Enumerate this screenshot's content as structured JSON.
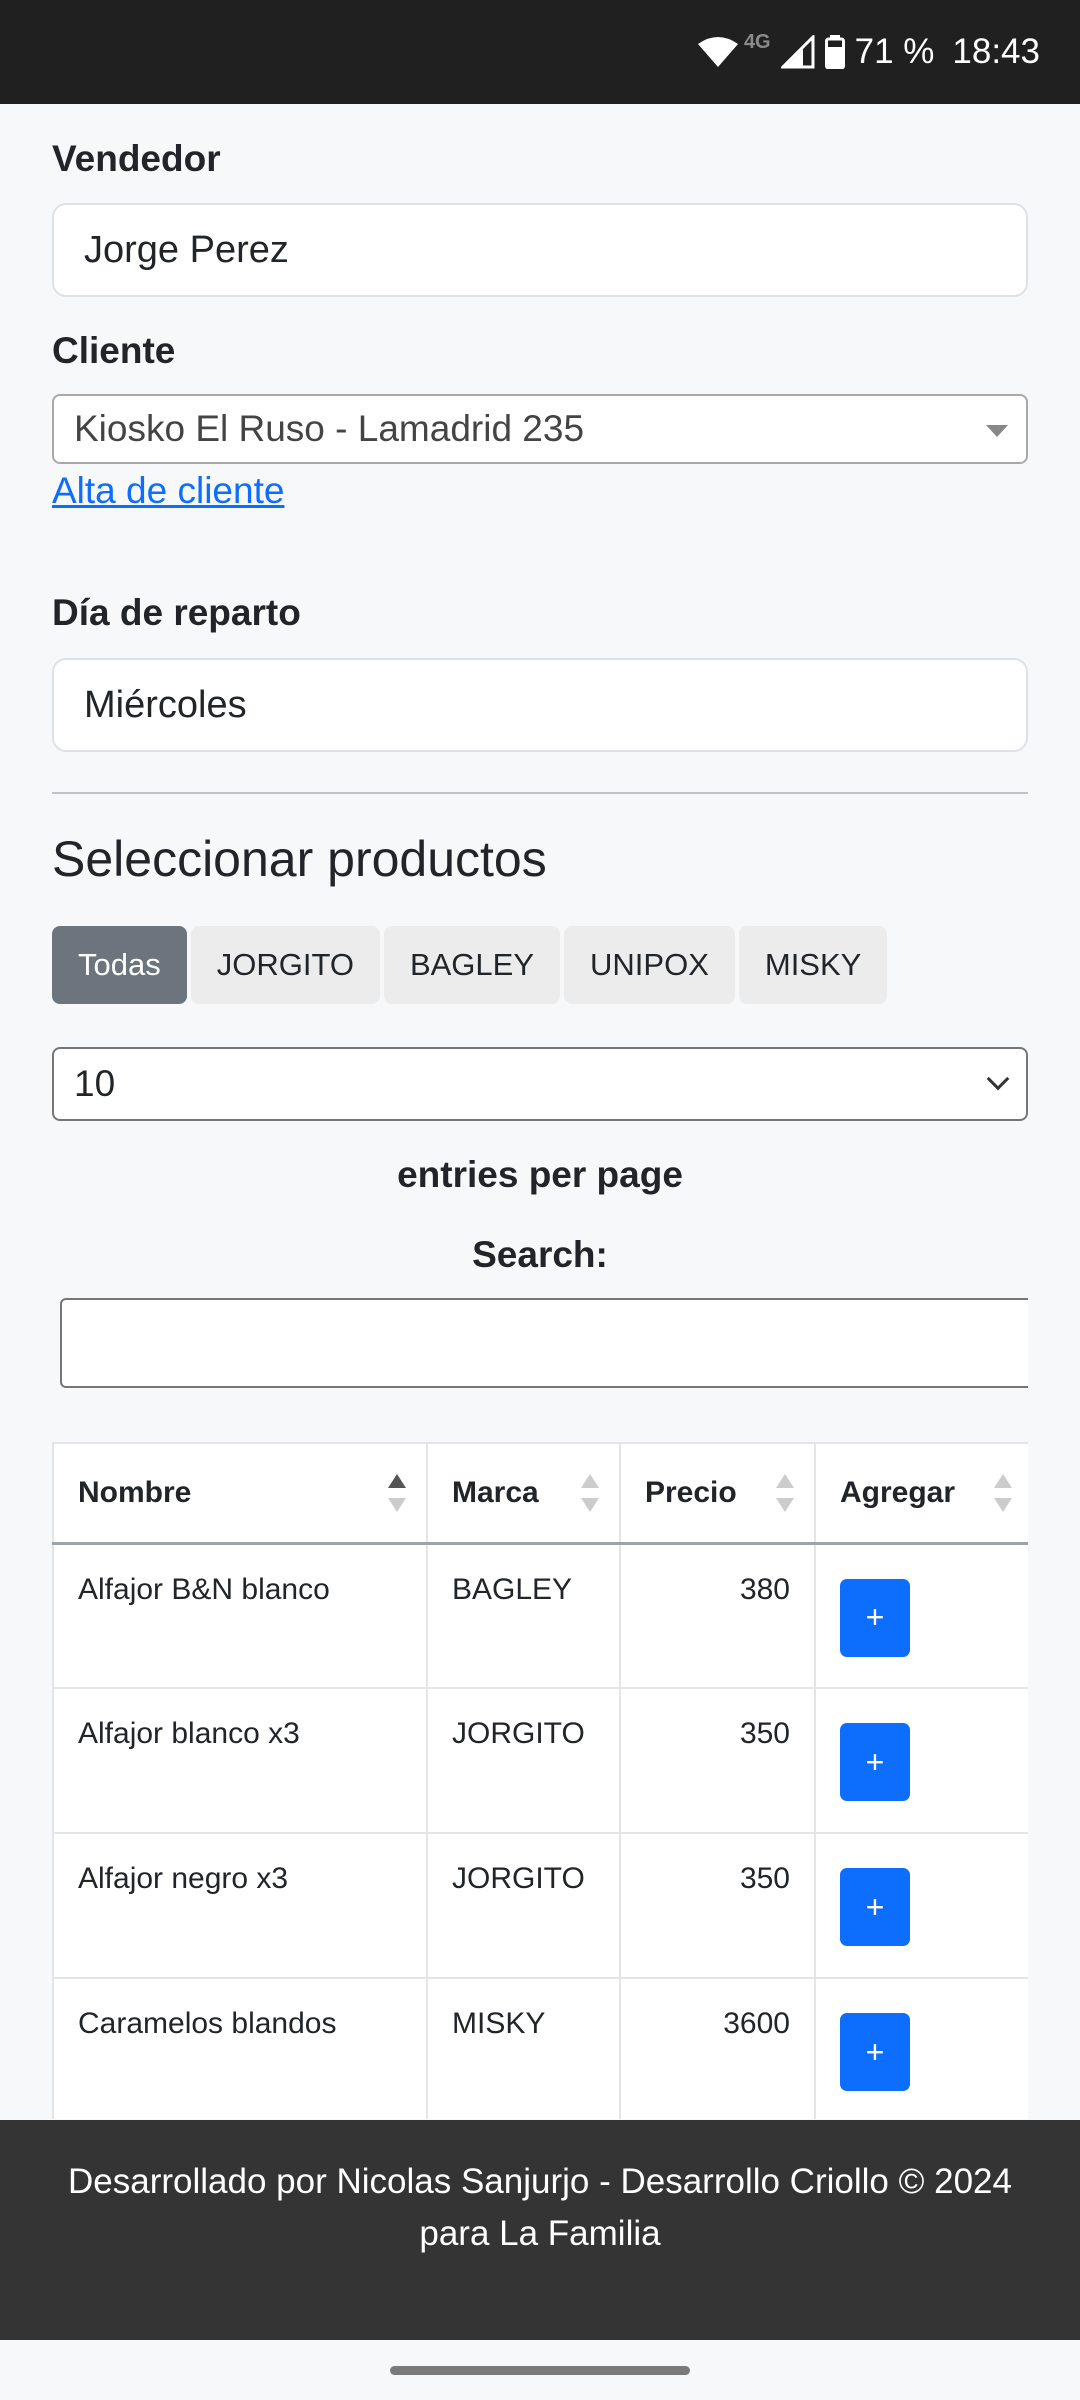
{
  "status_bar": {
    "network": "4G",
    "battery": "71 %",
    "time": "18:43"
  },
  "form": {
    "vendedor_label": "Vendedor",
    "vendedor_value": "Jorge Perez",
    "cliente_label": "Cliente",
    "cliente_value": "Kiosko El Ruso - Lamadrid 235",
    "alta_link": "Alta de cliente",
    "dia_label": "Día de reparto",
    "dia_value": "Miércoles"
  },
  "products": {
    "title": "Seleccionar productos",
    "filters": [
      "Todas",
      "JORGITO",
      "BAGLEY",
      "UNIPOX",
      "MISKY"
    ],
    "active_filter": "Todas",
    "page_size": "10",
    "entries_label": "entries per page",
    "search_label": "Search:",
    "search_value": "",
    "columns": [
      "Nombre",
      "Marca",
      "Precio",
      "Agregar"
    ],
    "sort_column": "Nombre",
    "sort_direction": "asc",
    "add_button_label": "+",
    "rows": [
      {
        "nombre": "Alfajor B&N blanco",
        "marca": "BAGLEY",
        "precio": "380"
      },
      {
        "nombre": "Alfajor blanco x3",
        "marca": "JORGITO",
        "precio": "350"
      },
      {
        "nombre": "Alfajor negro x3",
        "marca": "JORGITO",
        "precio": "350"
      },
      {
        "nombre": "Caramelos blandos",
        "marca": "MISKY",
        "precio": "3600"
      }
    ]
  },
  "footer": {
    "line1": "Desarrollado por Nicolas Sanjurjo - Desarrollo Criollo © 2024",
    "line2": "para La Familia"
  },
  "colors": {
    "primary": "#0d6efd",
    "secondary": "#6c757d",
    "footer_bg": "#343434",
    "status_bg": "#202020"
  }
}
